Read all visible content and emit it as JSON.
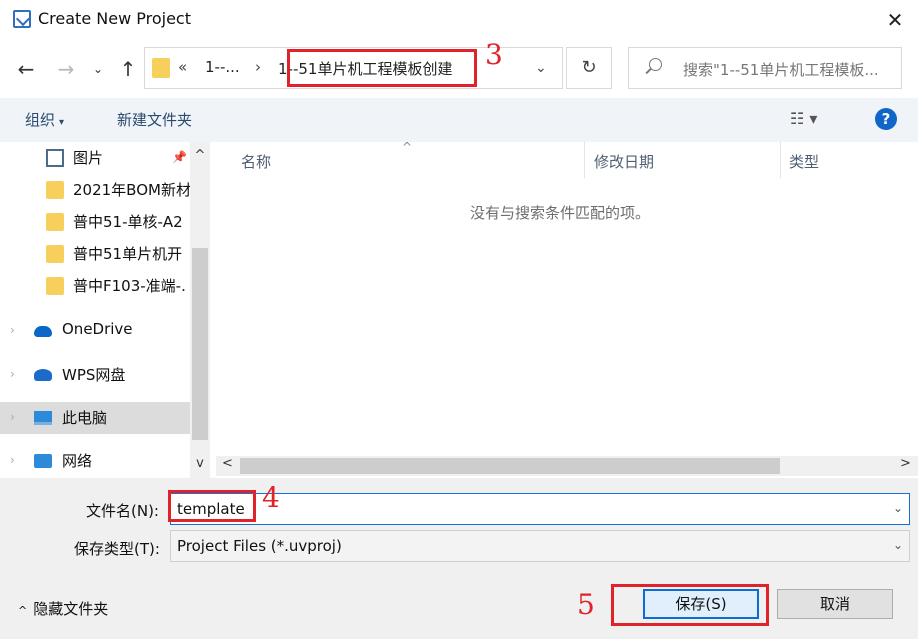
{
  "window": {
    "title": "Create New Project",
    "close_symbol": "✕"
  },
  "address": {
    "back_symbol": "←",
    "forward_symbol": "→",
    "recent_symbol": "⌄",
    "up_symbol": "↑",
    "overflow": "«",
    "crumbs": [
      "1--...",
      "1--51单片机工程模板创建"
    ],
    "separator": "›",
    "dropdown_symbol": "⌄",
    "refresh_symbol": "↻"
  },
  "search": {
    "placeholder": "搜索\"1--51单片机工程模板..."
  },
  "annotations": {
    "step3": "3",
    "step4": "4",
    "step5": "5",
    "color": "#e0232b"
  },
  "toolbar": {
    "organize": "组织",
    "organize_caret": "▾",
    "new_folder": "新建文件夹",
    "view_symbol": "☷ ▾",
    "help": "?"
  },
  "sidebar": {
    "pin_symbol": "📌",
    "chevron": "›",
    "items": [
      {
        "label": "图片",
        "icon": "pictures-icon"
      },
      {
        "label": "2021年BOM新材",
        "icon": "folder-icon"
      },
      {
        "label": "普中51-单核-A2",
        "icon": "folder-icon"
      },
      {
        "label": "普中51单片机开",
        "icon": "folder-icon"
      },
      {
        "label": "普中F103-准端-.",
        "icon": "folder-icon"
      },
      {
        "label": "OneDrive",
        "icon": "onedrive-icon"
      },
      {
        "label": "WPS网盘",
        "icon": "wps-cloud-icon"
      },
      {
        "label": "此电脑",
        "icon": "this-pc-icon"
      },
      {
        "label": "网络",
        "icon": "network-icon"
      }
    ],
    "scroll_up": "^",
    "scroll_down": "v"
  },
  "file_list": {
    "columns": [
      "名称",
      "修改日期",
      "类型"
    ],
    "sort_caret": "^",
    "empty_message": "没有与搜索条件匹配的项。",
    "scroll_left": "<",
    "scroll_right": ">"
  },
  "form": {
    "filename_label": "文件名(N):",
    "filename_value": "template",
    "filetype_label": "保存类型(T):",
    "filetype_value": "Project Files (*.uvproj)",
    "caret": "⌄"
  },
  "footer": {
    "hide_folders_caret": "^",
    "hide_folders": "隐藏文件夹",
    "save": "保存(S)",
    "cancel": "取消"
  }
}
